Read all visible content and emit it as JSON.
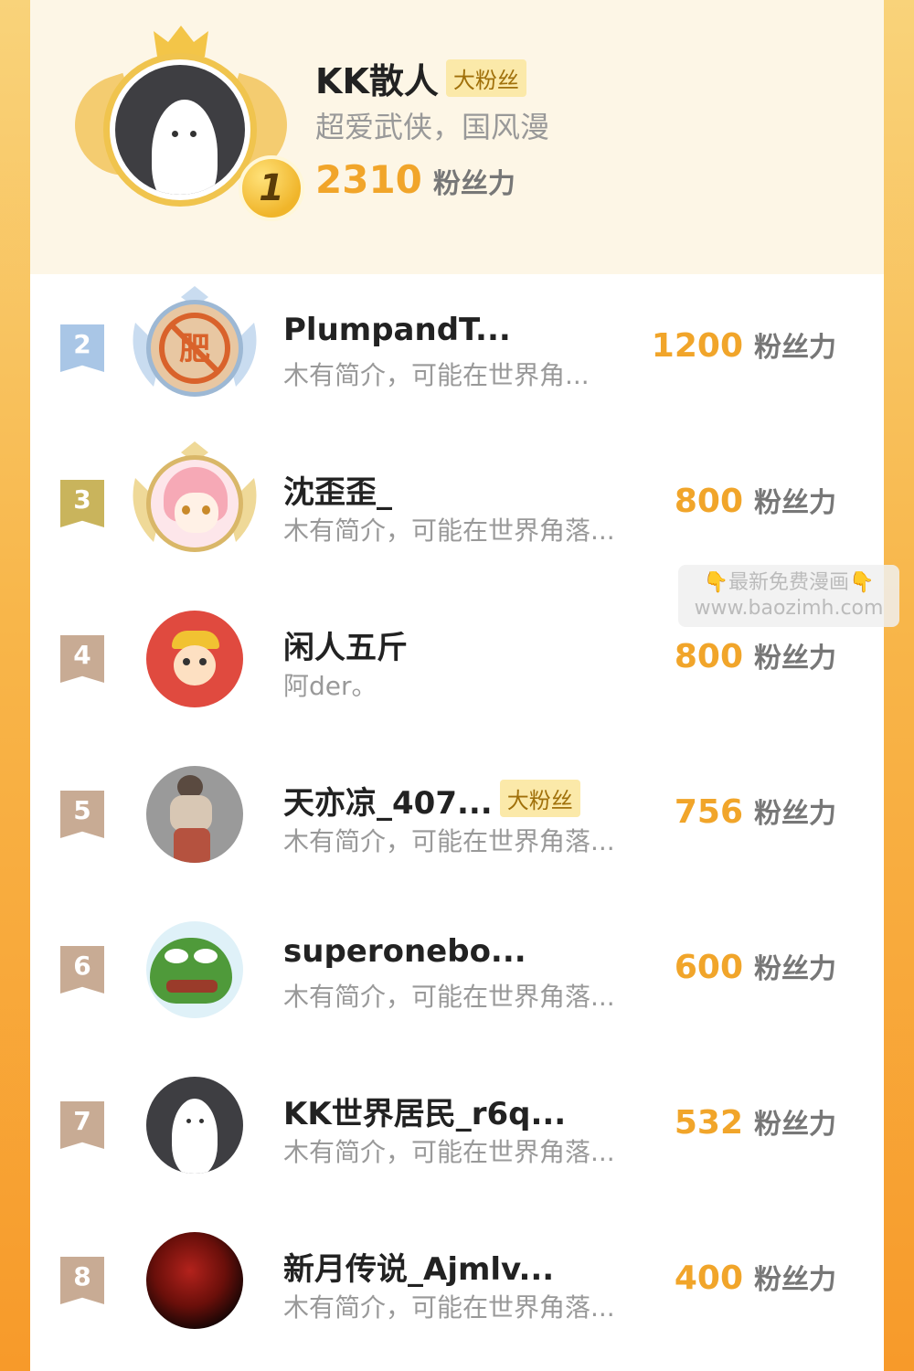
{
  "top_user": {
    "rank": "1",
    "name": "KK散人",
    "badge": "大粉丝",
    "bio": "超爱武侠，国风漫",
    "score": "2310",
    "unit": "粉丝力"
  },
  "rows": [
    {
      "rank": "2",
      "name": "PlumpandT...",
      "badge": "",
      "bio": "木有简介，可能在世界角...",
      "score": "1200",
      "unit": "粉丝力"
    },
    {
      "rank": "3",
      "name": "沈歪歪_",
      "badge": "",
      "bio": "木有简介，可能在世界角落...",
      "score": "800",
      "unit": "粉丝力"
    },
    {
      "rank": "4",
      "name": "闲人五斤",
      "badge": "",
      "bio": "阿der。",
      "score": "800",
      "unit": "粉丝力"
    },
    {
      "rank": "5",
      "name": "天亦凉_407...",
      "badge": "大粉丝",
      "bio": "木有简介，可能在世界角落...",
      "score": "756",
      "unit": "粉丝力"
    },
    {
      "rank": "6",
      "name": "superonebo...",
      "badge": "",
      "bio": "木有简介，可能在世界角落...",
      "score": "600",
      "unit": "粉丝力"
    },
    {
      "rank": "7",
      "name": "KK世界居民_r6q...",
      "badge": "",
      "bio": "木有简介，可能在世界角落...",
      "score": "532",
      "unit": "粉丝力"
    },
    {
      "rank": "8",
      "name": "新月传说_Ajmlv...",
      "badge": "",
      "bio": "木有简介，可能在世界角落...",
      "score": "400",
      "unit": "粉丝力"
    }
  ],
  "watermark": {
    "line1": "👇最新免费漫画👇",
    "line2": "www.baozimh.com"
  },
  "colors": {
    "score": "#f1a52a",
    "rank2": "#9fc0e0",
    "rank3": "#c9b25a",
    "rank_other": "#c8ab94"
  }
}
